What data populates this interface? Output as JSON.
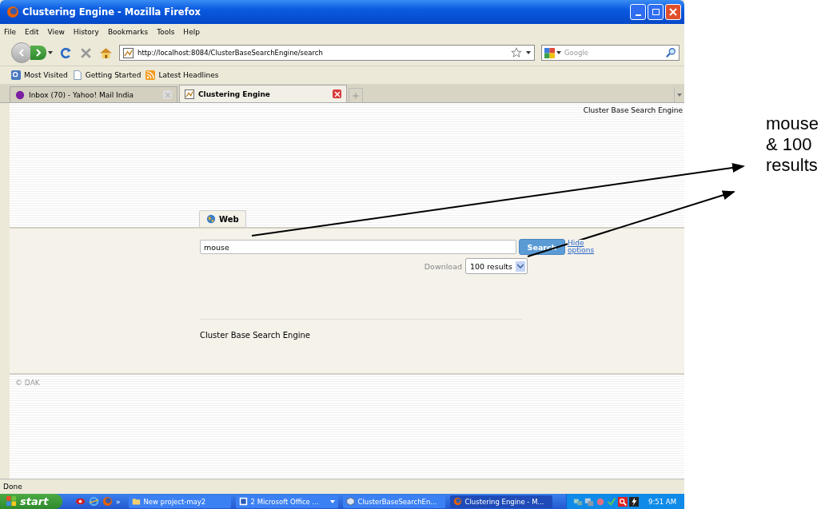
{
  "window": {
    "title": "Clustering Engine - Mozilla Firefox"
  },
  "menu": [
    "File",
    "Edit",
    "View",
    "History",
    "Bookmarks",
    "Tools",
    "Help"
  ],
  "address": {
    "value": "http://localhost:8084/ClusterBaseSearchEngine/search"
  },
  "web_search": {
    "placeholder": "Google"
  },
  "bookmarks": [
    "Most Visited",
    "Getting Started",
    "Latest Headlines"
  ],
  "tabs": [
    {
      "label": "Inbox (70) - Yahoo! Mail India",
      "selected": false
    },
    {
      "label": "Clustering Engine",
      "selected": true
    }
  ],
  "page": {
    "header": "Cluster Base Search Engine",
    "search_tabs": [
      {
        "label": "Web",
        "selected": true
      }
    ],
    "query": "mouse",
    "search_button": "Search",
    "options_link": "Hide options",
    "download_label": "Download",
    "download_select": "100 results",
    "footer": "Cluster Base Search Engine",
    "copyright": "© DAK"
  },
  "status_bar": "Done",
  "taskbar": {
    "start": "start",
    "chevron": "»",
    "tasks": [
      {
        "label": "New project-may2",
        "selected": false
      },
      {
        "label": "2 Microsoft Office ...",
        "selected": false
      },
      {
        "label": "ClusterBaseSearchEn...",
        "selected": false
      },
      {
        "label": "Clustering Engine - M...",
        "selected": true
      }
    ],
    "clock": "9:51 AM"
  },
  "annotation": {
    "lines": [
      "mouse",
      "& 100",
      "results"
    ]
  }
}
